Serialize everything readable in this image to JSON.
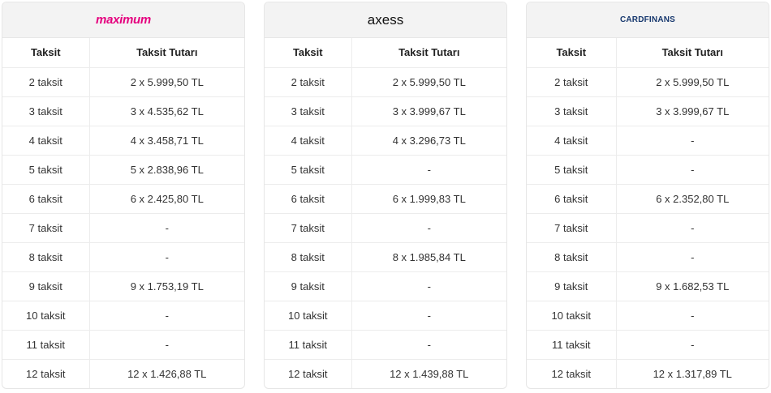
{
  "headers": {
    "count": "Taksit",
    "amount": "Taksit Tutarı"
  },
  "cards": [
    {
      "brand": "maximum",
      "brand_color": "#e5007e",
      "rows": [
        {
          "count": "2 taksit",
          "amount": "2 x 5.999,50 TL"
        },
        {
          "count": "3 taksit",
          "amount": "3 x 4.535,62 TL"
        },
        {
          "count": "4 taksit",
          "amount": "4 x 3.458,71 TL"
        },
        {
          "count": "5 taksit",
          "amount": "5 x 2.838,96 TL"
        },
        {
          "count": "6 taksit",
          "amount": "6 x 2.425,80 TL"
        },
        {
          "count": "7 taksit",
          "amount": "-"
        },
        {
          "count": "8 taksit",
          "amount": "-"
        },
        {
          "count": "9 taksit",
          "amount": "9 x 1.753,19 TL"
        },
        {
          "count": "10 taksit",
          "amount": "-"
        },
        {
          "count": "11 taksit",
          "amount": "-"
        },
        {
          "count": "12 taksit",
          "amount": "12 x 1.426,88 TL"
        }
      ]
    },
    {
      "brand": "axess",
      "brand_color": "#111111",
      "rows": [
        {
          "count": "2 taksit",
          "amount": "2 x 5.999,50 TL"
        },
        {
          "count": "3 taksit",
          "amount": "3 x 3.999,67 TL"
        },
        {
          "count": "4 taksit",
          "amount": "4 x 3.296,73 TL"
        },
        {
          "count": "5 taksit",
          "amount": "-"
        },
        {
          "count": "6 taksit",
          "amount": "6 x 1.999,83 TL"
        },
        {
          "count": "7 taksit",
          "amount": "-"
        },
        {
          "count": "8 taksit",
          "amount": "8 x 1.985,84 TL"
        },
        {
          "count": "9 taksit",
          "amount": "-"
        },
        {
          "count": "10 taksit",
          "amount": "-"
        },
        {
          "count": "11 taksit",
          "amount": "-"
        },
        {
          "count": "12 taksit",
          "amount": "12 x 1.439,88 TL"
        }
      ]
    },
    {
      "brand": "CARDFINANS",
      "brand_color": "#17386e",
      "rows": [
        {
          "count": "2 taksit",
          "amount": "2 x 5.999,50 TL"
        },
        {
          "count": "3 taksit",
          "amount": "3 x 3.999,67 TL"
        },
        {
          "count": "4 taksit",
          "amount": "-"
        },
        {
          "count": "5 taksit",
          "amount": "-"
        },
        {
          "count": "6 taksit",
          "amount": "6 x 2.352,80 TL"
        },
        {
          "count": "7 taksit",
          "amount": "-"
        },
        {
          "count": "8 taksit",
          "amount": "-"
        },
        {
          "count": "9 taksit",
          "amount": "9 x 1.682,53 TL"
        },
        {
          "count": "10 taksit",
          "amount": "-"
        },
        {
          "count": "11 taksit",
          "amount": "-"
        },
        {
          "count": "12 taksit",
          "amount": "12 x 1.317,89 TL"
        }
      ]
    }
  ]
}
